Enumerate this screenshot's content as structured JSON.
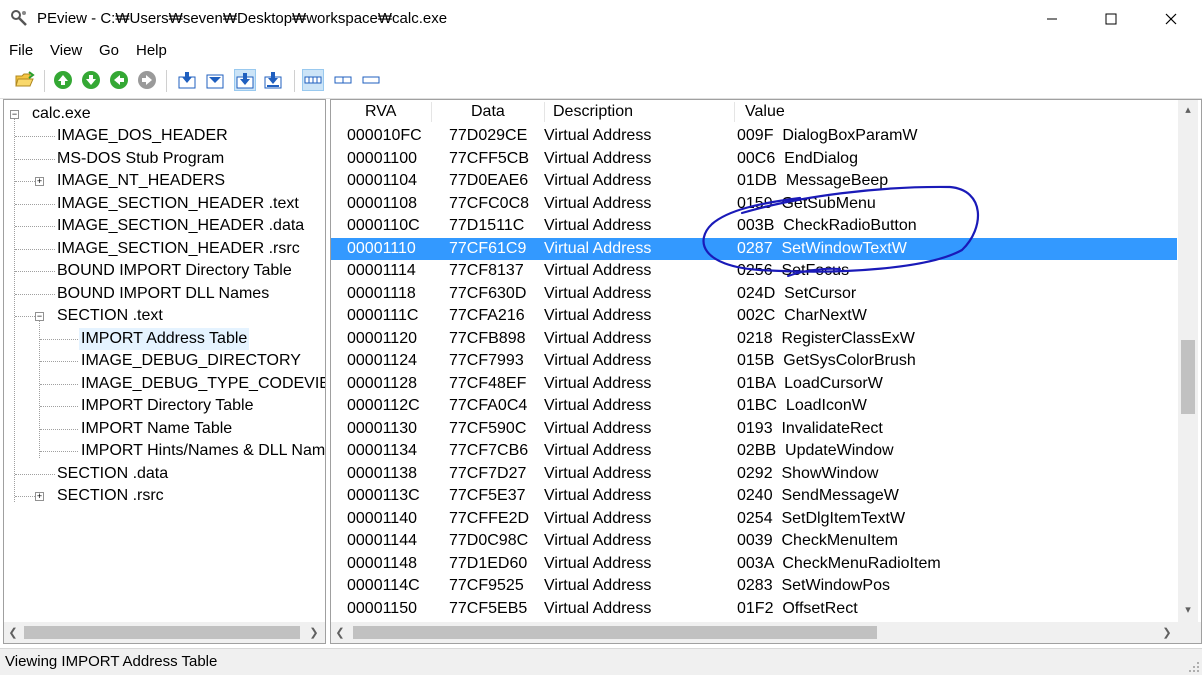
{
  "window": {
    "title": "PEview - C:₩Users₩seven₩Desktop₩workspace₩calc.exe",
    "minimize_label": "—",
    "maximize_label": "☐",
    "close_label": "✕"
  },
  "menu": [
    "File",
    "View",
    "Go",
    "Help"
  ],
  "toolbar": {
    "icons": [
      "open-folder-icon",
      "back-icon",
      "forward-icon",
      "previous-icon",
      "next-icon",
      "expand-all-icon",
      "collapse-icon",
      "go-to-selected-icon",
      "go-to-bottom-icon",
      "view-byte-icon",
      "view-word-icon",
      "view-dword-icon"
    ]
  },
  "tree": [
    {
      "label": "calc.exe",
      "level": 0,
      "expander": "-"
    },
    {
      "label": "IMAGE_DOS_HEADER",
      "level": 1
    },
    {
      "label": "MS-DOS Stub Program",
      "level": 1
    },
    {
      "label": "IMAGE_NT_HEADERS",
      "level": 1,
      "expander": "+"
    },
    {
      "label": "IMAGE_SECTION_HEADER .text",
      "level": 1
    },
    {
      "label": "IMAGE_SECTION_HEADER .data",
      "level": 1
    },
    {
      "label": "IMAGE_SECTION_HEADER .rsrc",
      "level": 1
    },
    {
      "label": "BOUND IMPORT Directory Table",
      "level": 1
    },
    {
      "label": "BOUND IMPORT DLL Names",
      "level": 1
    },
    {
      "label": "SECTION .text",
      "level": 1,
      "expander": "-"
    },
    {
      "label": "IMPORT Address Table",
      "level": 2,
      "selected": true
    },
    {
      "label": "IMAGE_DEBUG_DIRECTORY",
      "level": 2
    },
    {
      "label": "IMAGE_DEBUG_TYPE_CODEVIEW",
      "level": 2
    },
    {
      "label": "IMPORT Directory Table",
      "level": 2
    },
    {
      "label": "IMPORT Name Table",
      "level": 2
    },
    {
      "label": "IMPORT Hints/Names & DLL Names",
      "level": 2
    },
    {
      "label": "SECTION .data",
      "level": 1
    },
    {
      "label": "SECTION .rsrc",
      "level": 1,
      "expander": "+"
    }
  ],
  "table": {
    "headers": [
      "RVA",
      "Data",
      "Description",
      "Value"
    ],
    "rows": [
      [
        "000010FC",
        "77D029CE",
        "Virtual Address",
        "009F  DialogBoxParamW"
      ],
      [
        "00001100",
        "77CFF5CB",
        "Virtual Address",
        "00C6  EndDialog"
      ],
      [
        "00001104",
        "77D0EAE6",
        "Virtual Address",
        "01DB  MessageBeep"
      ],
      [
        "00001108",
        "77CFC0C8",
        "Virtual Address",
        "0159  GetSubMenu"
      ],
      [
        "0000110C",
        "77D1511C",
        "Virtual Address",
        "003B  CheckRadioButton"
      ],
      [
        "00001110",
        "77CF61C9",
        "Virtual Address",
        "0287  SetWindowTextW"
      ],
      [
        "00001114",
        "77CF8137",
        "Virtual Address",
        "0256  SetFocus"
      ],
      [
        "00001118",
        "77CF630D",
        "Virtual Address",
        "024D  SetCursor"
      ],
      [
        "0000111C",
        "77CFA216",
        "Virtual Address",
        "002C  CharNextW"
      ],
      [
        "00001120",
        "77CFB898",
        "Virtual Address",
        "0218  RegisterClassExW"
      ],
      [
        "00001124",
        "77CF7993",
        "Virtual Address",
        "015B  GetSysColorBrush"
      ],
      [
        "00001128",
        "77CF48EF",
        "Virtual Address",
        "01BA  LoadCursorW"
      ],
      [
        "0000112C",
        "77CFA0C4",
        "Virtual Address",
        "01BC  LoadIconW"
      ],
      [
        "00001130",
        "77CF590C",
        "Virtual Address",
        "0193  InvalidateRect"
      ],
      [
        "00001134",
        "77CF7CB6",
        "Virtual Address",
        "02BB  UpdateWindow"
      ],
      [
        "00001138",
        "77CF7D27",
        "Virtual Address",
        "0292  ShowWindow"
      ],
      [
        "0000113C",
        "77CF5E37",
        "Virtual Address",
        "0240  SendMessageW"
      ],
      [
        "00001140",
        "77CFFE2D",
        "Virtual Address",
        "0254  SetDlgItemTextW"
      ],
      [
        "00001144",
        "77D0C98C",
        "Virtual Address",
        "0039  CheckMenuItem"
      ],
      [
        "00001148",
        "77D1ED60",
        "Virtual Address",
        "003A  CheckMenuRadioItem"
      ],
      [
        "0000114C",
        "77CF9525",
        "Virtual Address",
        "0283  SetWindowPos"
      ],
      [
        "00001150",
        "77CF5EB5",
        "Virtual Address",
        "01F2  OffsetRect"
      ]
    ],
    "selected_row": 5
  },
  "status": "Viewing IMPORT Address Table",
  "colors": {
    "selection": "#3399ff",
    "annotation": "#1a1ab8",
    "tree_selection": "#e5f3ff"
  }
}
